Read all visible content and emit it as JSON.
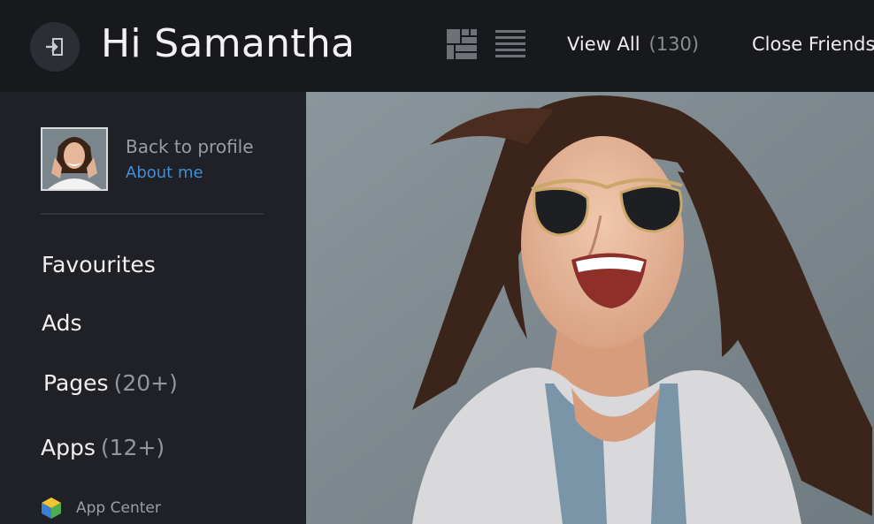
{
  "header": {
    "greeting": "Hi Samantha",
    "nav": [
      {
        "label": "View All",
        "count": "(130)"
      },
      {
        "label": "Close Friends"
      }
    ],
    "icons": [
      "exit-icon",
      "grid-view-icon",
      "list-view-icon"
    ]
  },
  "sidebar": {
    "profile": {
      "back_label": "Back to profile",
      "about_label": "About me"
    },
    "items": [
      {
        "label": "Favourites"
      },
      {
        "label": "Ads"
      },
      {
        "label": "Pages",
        "count": "(20+)"
      },
      {
        "label": "Apps",
        "count": "(12+)"
      }
    ],
    "app_center": {
      "label": "App Center",
      "icon": "app-center-cube-icon"
    }
  },
  "colors": {
    "header_bg": "#18191d",
    "sidebar_bg": "#1f2127",
    "link_blue": "#3f8fd8",
    "muted_text": "#8a8c93"
  }
}
